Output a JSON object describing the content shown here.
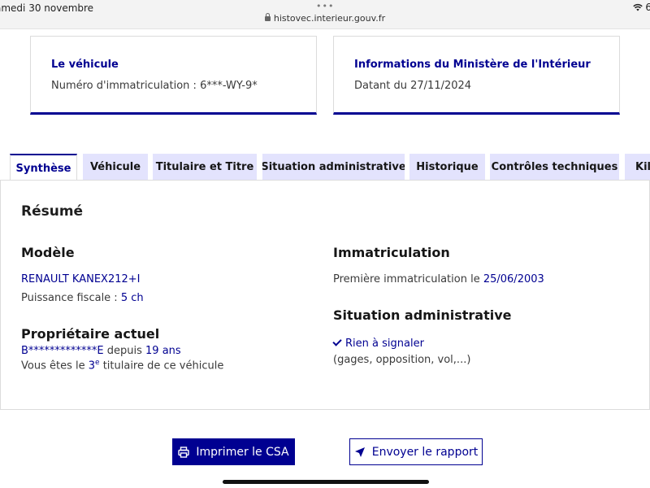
{
  "status_bar": {
    "date": "amedi 30 novembre",
    "dots": "•••",
    "url": "histovec.interieur.gouv.fr",
    "battery": "6"
  },
  "cards": {
    "vehicle": {
      "title": "Le véhicule",
      "text": "Numéro d'immatriculation : 6***-WY-9*"
    },
    "ministry": {
      "title": "Informations du Ministère de l'Intérieur",
      "text": "Datant du 27/11/2024"
    }
  },
  "tabs": [
    {
      "label": "Synthèse",
      "active": true
    },
    {
      "label": "Véhicule",
      "active": false
    },
    {
      "label": "Titulaire et Titre",
      "active": false
    },
    {
      "label": "Situation administrative",
      "active": false
    },
    {
      "label": "Historique",
      "active": false
    },
    {
      "label": "Contrôles techniques",
      "active": false
    },
    {
      "label": "Kilo",
      "active": false
    }
  ],
  "summary": {
    "title": "Résumé",
    "model": {
      "heading": "Modèle",
      "name": "RENAULT KANEX212+I",
      "power_label": "Puissance fiscale : ",
      "power_value": "5 ch"
    },
    "owner": {
      "heading": "Propriétaire actuel",
      "name": "B*************E",
      "since_label": " depuis ",
      "since_value": "19 ans",
      "rank_prefix": "Vous êtes le ",
      "rank_number": "3",
      "rank_sup": "e",
      "rank_suffix": " titulaire de ce véhicule"
    },
    "registration": {
      "heading": "Immatriculation",
      "first_label": "Première immatriculation le ",
      "first_date": "25/06/2003"
    },
    "admin": {
      "heading": "Situation administrative",
      "status": "Rien à signaler",
      "details": "(gages, opposition, vol,...)"
    }
  },
  "buttons": {
    "print": "Imprimer le CSA",
    "send": "Envoyer le rapport"
  },
  "colors": {
    "primary": "#000091",
    "tab_bg": "#e3e3fd"
  }
}
